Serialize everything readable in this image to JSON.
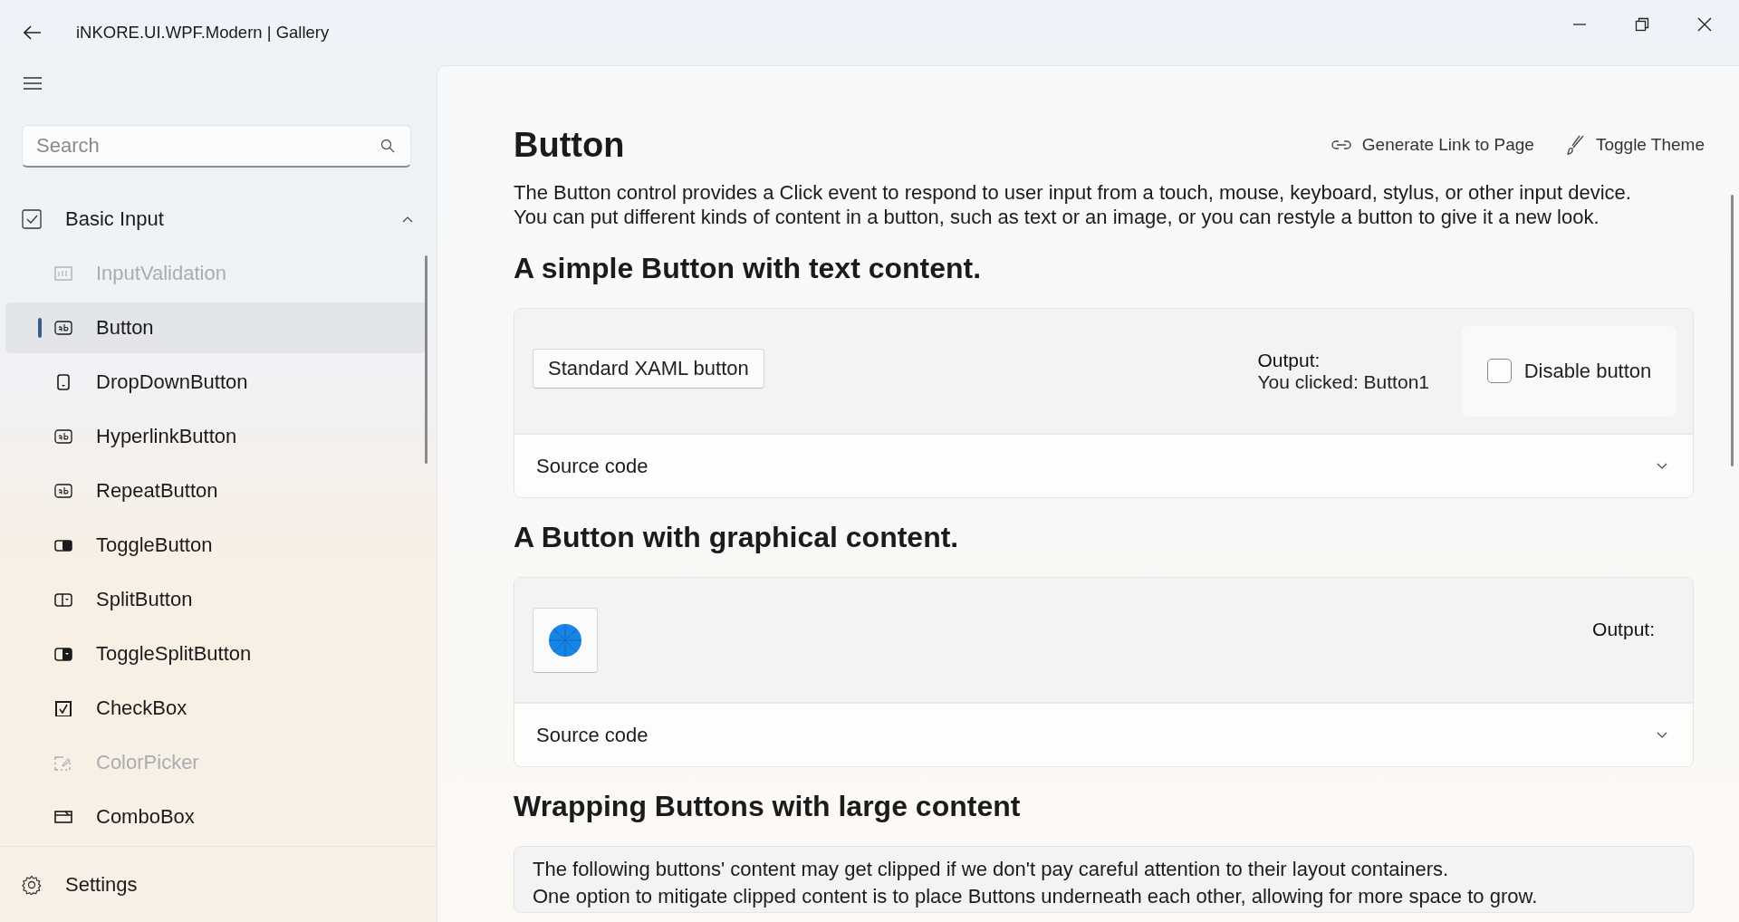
{
  "window": {
    "title": "iNKORE.UI.WPF.Modern | Gallery"
  },
  "sidebar": {
    "search": {
      "placeholder": "Search"
    },
    "category": {
      "label": "Basic Input",
      "expanded": true,
      "items": [
        {
          "label": "InputValidation",
          "kind": "textbox",
          "selected": false,
          "disabled": true
        },
        {
          "label": "Button",
          "kind": "ab",
          "selected": true,
          "disabled": false
        },
        {
          "label": "DropDownButton",
          "kind": "dropdown",
          "selected": false,
          "disabled": false
        },
        {
          "label": "HyperlinkButton",
          "kind": "ab",
          "selected": false,
          "disabled": false
        },
        {
          "label": "RepeatButton",
          "kind": "ab",
          "selected": false,
          "disabled": false
        },
        {
          "label": "ToggleButton",
          "kind": "toggle",
          "selected": false,
          "disabled": false
        },
        {
          "label": "SplitButton",
          "kind": "split",
          "selected": false,
          "disabled": false
        },
        {
          "label": "ToggleSplitButton",
          "kind": "togglesplit",
          "selected": false,
          "disabled": false
        },
        {
          "label": "CheckBox",
          "kind": "checkbox",
          "selected": false,
          "disabled": false
        },
        {
          "label": "ColorPicker",
          "kind": "colorpicker",
          "selected": false,
          "disabled": true
        },
        {
          "label": "ComboBox",
          "kind": "combobox",
          "selected": false,
          "disabled": false
        }
      ]
    },
    "footer": {
      "label": "Settings"
    }
  },
  "page": {
    "title": "Button",
    "actions": [
      {
        "label": "Generate Link to Page",
        "kind": "link"
      },
      {
        "label": "Toggle Theme",
        "kind": "theme"
      }
    ],
    "description": "The Button control provides a Click event to respond to user input from a touch, mouse, keyboard, stylus, or other input device. You can put different kinds of content in a button, such as text or an image, or you can restyle a button to give it a new look.",
    "sections": [
      {
        "heading": "A simple Button with text content.",
        "kind": "text_button",
        "button": "Standard XAML button",
        "output_label": "Output:",
        "output_value": "You clicked: Button1",
        "option": {
          "label": "Disable button",
          "checked": false
        },
        "source": {
          "label": "Source code",
          "expanded": false
        }
      },
      {
        "heading": "A Button with graphical content.",
        "kind": "graphic_button",
        "output_label": "Output:",
        "source": {
          "label": "Source code",
          "expanded": false
        }
      },
      {
        "heading": "Wrapping Buttons with large content",
        "kind": "text_card",
        "lines": [
          "The following buttons' content may get clipped if we don't pay careful attention to their layout containers.",
          "One option to mitigate clipped content is to place Buttons underneath each other, allowing for more space to grow."
        ]
      }
    ]
  }
}
